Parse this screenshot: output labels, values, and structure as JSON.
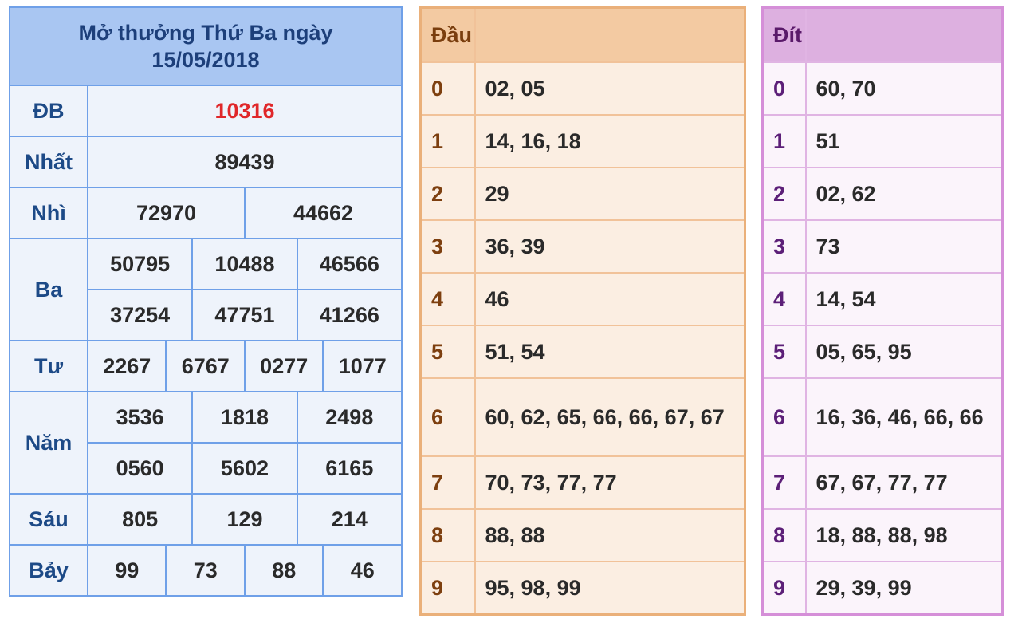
{
  "results": {
    "title_line1": "Mở thưởng Thứ Ba ngày",
    "title_line2": "15/05/2018",
    "prizes": {
      "db": {
        "label": "ĐB",
        "values": [
          "10316"
        ]
      },
      "nhat": {
        "label": "Nhất",
        "values": [
          "89439"
        ]
      },
      "nhi": {
        "label": "Nhì",
        "values": [
          "72970",
          "44662"
        ]
      },
      "ba": {
        "label": "Ba",
        "values": [
          "50795",
          "10488",
          "46566",
          "37254",
          "47751",
          "41266"
        ]
      },
      "tu": {
        "label": "Tư",
        "values": [
          "2267",
          "6767",
          "0277",
          "1077"
        ]
      },
      "nam": {
        "label": "Năm",
        "values": [
          "3536",
          "1818",
          "2498",
          "0560",
          "5602",
          "6165"
        ]
      },
      "sau": {
        "label": "Sáu",
        "values": [
          "805",
          "129",
          "214"
        ]
      },
      "bay": {
        "label": "Bảy",
        "values": [
          "99",
          "73",
          "88",
          "46"
        ]
      }
    },
    "colors": {
      "special": "#e0272a",
      "header_bg": "#a9c6f2",
      "border": "#6fa0e8"
    }
  },
  "dau": {
    "header": "Đầu",
    "rows": [
      {
        "digit": "0",
        "values": "02, 05"
      },
      {
        "digit": "1",
        "values": "14, 16, 18"
      },
      {
        "digit": "2",
        "values": "29"
      },
      {
        "digit": "3",
        "values": "36, 39"
      },
      {
        "digit": "4",
        "values": "46"
      },
      {
        "digit": "5",
        "values": "51, 54"
      },
      {
        "digit": "6",
        "values": "60, 62, 65, 66, 66, 67, 67"
      },
      {
        "digit": "7",
        "values": "70, 73, 77, 77"
      },
      {
        "digit": "8",
        "values": "88, 88"
      },
      {
        "digit": "9",
        "values": "95, 98, 99"
      }
    ]
  },
  "dit": {
    "header": "Đít",
    "rows": [
      {
        "digit": "0",
        "values": "60, 70"
      },
      {
        "digit": "1",
        "values": "51"
      },
      {
        "digit": "2",
        "values": "02, 62"
      },
      {
        "digit": "3",
        "values": "73"
      },
      {
        "digit": "4",
        "values": "14, 54"
      },
      {
        "digit": "5",
        "values": "05, 65, 95"
      },
      {
        "digit": "6",
        "values": "16, 36, 46, 66, 66"
      },
      {
        "digit": "7",
        "values": "67, 67, 77, 77"
      },
      {
        "digit": "8",
        "values": "18, 88, 88, 98"
      },
      {
        "digit": "9",
        "values": "29, 39, 99"
      }
    ]
  }
}
